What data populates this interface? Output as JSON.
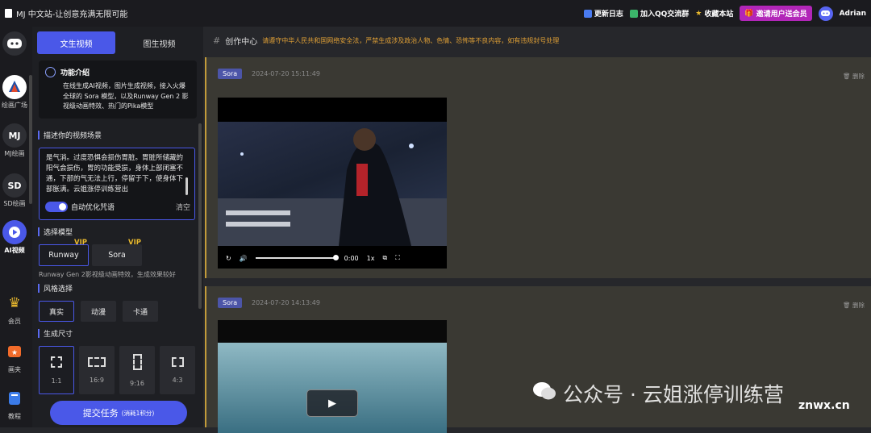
{
  "header": {
    "app_title": "MJ 中文站-让创意充满无限可能",
    "links": [
      {
        "label": "更新日志",
        "color": "#4a7bf0"
      },
      {
        "label": "加入QQ交流群",
        "color": "#3bb56a"
      },
      {
        "label": "收藏本站",
        "color": "#e9b92e"
      }
    ],
    "invite_label": "邀请用户送会员",
    "username": "Adrian"
  },
  "rail": {
    "items": [
      {
        "label": "",
        "icon": "discord-icon"
      },
      {
        "label": "绘画广场",
        "icon": "gallery-logo-icon"
      },
      {
        "label": "MJ绘画",
        "badge": "MJ"
      },
      {
        "label": "SD绘画",
        "badge": "SD"
      },
      {
        "label": "AI视频",
        "icon": "play-circle-icon"
      },
      {
        "label": "会员",
        "icon": "crown-icon"
      },
      {
        "label": "画夹",
        "icon": "folder-icon"
      },
      {
        "label": "教程",
        "icon": "book-icon"
      }
    ]
  },
  "panel": {
    "tabs": [
      "文生视频",
      "图生视频"
    ],
    "intro": {
      "title": "功能介绍",
      "text": "在线生成AI视频，图片生成视频，接入火爆全球的 Sora 模型，以及Runway Gen 2 影视级动画特效、热门的Pika模型"
    },
    "scene_title": "描述你的视频场景",
    "prompt_text": "是气消。过度恐惧会损伤胃脏。胃脏所储藏的阳气会损伤，胃的功能受损，身体上部闭塞不通，下部的气无法上行，停留于下，使身体下部胀满。云姐涨停训练营出",
    "toggle_label": "自动优化咒语",
    "clear_label": "清空",
    "model_title": "选择模型",
    "models": [
      "Runway",
      "Sora"
    ],
    "vip_label": "VIP",
    "model_desc": "Runway Gen 2影视级动画特效，生成效果较好",
    "style_title": "风格选择",
    "styles": [
      "真实",
      "动漫",
      "卡通"
    ],
    "size_title": "生成尺寸",
    "sizes": [
      "1:1",
      "16:9",
      "9:16",
      "4:3"
    ],
    "submit_label": "提交任务",
    "submit_cost": "(消耗1积分)"
  },
  "main": {
    "title": "创作中心",
    "notice": "请遵守中华人民共和国网络安全法，严禁生成涉及政治人物、色情、恐怖等不良内容，如有违规封号处理",
    "cards": [
      {
        "tag": "Sora",
        "date": "2024-07-20 15:11:49",
        "delete": "删除",
        "time": "0:00",
        "speed": "1x"
      },
      {
        "tag": "Sora",
        "date": "2024-07-20 14:13:49",
        "delete": "删除"
      }
    ]
  },
  "watermark": {
    "text": "公众号 · 云姐涨停训练营",
    "site": "znwx.cn"
  }
}
